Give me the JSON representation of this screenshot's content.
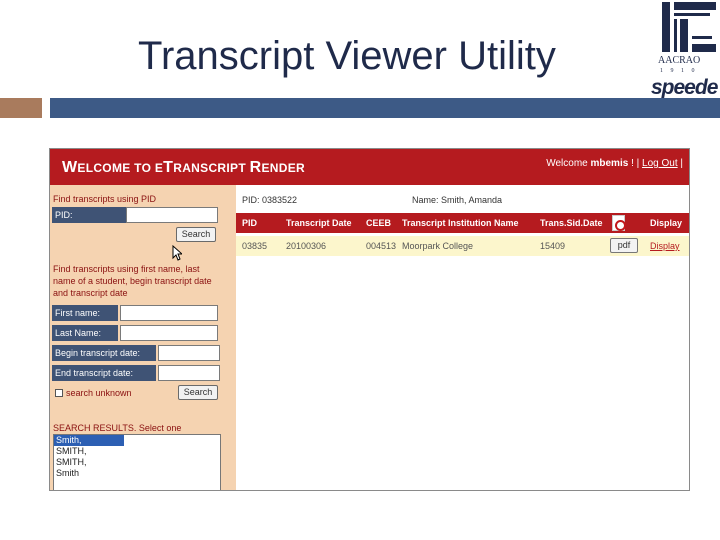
{
  "slide": {
    "title": "Transcript Viewer Utility",
    "logo": {
      "brand": "AACRAO",
      "years": "1 9 1 0",
      "product": "speede"
    }
  },
  "app": {
    "title_part1": "W",
    "title_part2": "ELCOME TO ",
    "title_part3": "E",
    "title_part4": "T",
    "title_part5": "RANSCRIPT ",
    "title_part6": "R",
    "title_part7": "ENDER",
    "welcome_prefix": "Welcome",
    "welcome_user": "mbemis",
    "welcome_suffix": "! |",
    "logout": "Log Out",
    "welcome_end": "|"
  },
  "sidebar": {
    "find_pid_heading": "Find transcripts using PID",
    "pid_label": "PID:",
    "pid_value": "",
    "search_button": "Search",
    "find_name_line1": "Find transcripts using first name, last",
    "find_name_line2": "name of a student, begin transcript date",
    "find_name_line3": "and transcript date",
    "first_name_label": "First name:",
    "last_name_label": "Last Name:",
    "begin_date_label": "Begin transcript date:",
    "end_date_label": "End transcript date:",
    "search_unknown": "search unknown",
    "search_button_2": "Search",
    "results_heading": "SEARCH RESULTS. Select one",
    "results": [
      "Smith,",
      "SMITH,",
      "SMITH,",
      "Smith"
    ]
  },
  "main": {
    "pid_text": "PID: 0383522",
    "name_text": "Name: Smith, Amanda",
    "columns": [
      "PID",
      "Transcript Date",
      "CEEB",
      "Transcript Institution Name",
      "Trans.Sid.Date",
      "Display"
    ],
    "row": {
      "pid": "03835",
      "date": "20100306",
      "ceeb": "004513",
      "institution": "Moorpark College",
      "sid": "15409",
      "pdf": "pdf",
      "display": "Display"
    }
  },
  "colors": {
    "header_red": "#b51b1f",
    "navy": "#3d5a86",
    "tan": "#a97b5d",
    "sidebar": "#f5d3b1"
  }
}
